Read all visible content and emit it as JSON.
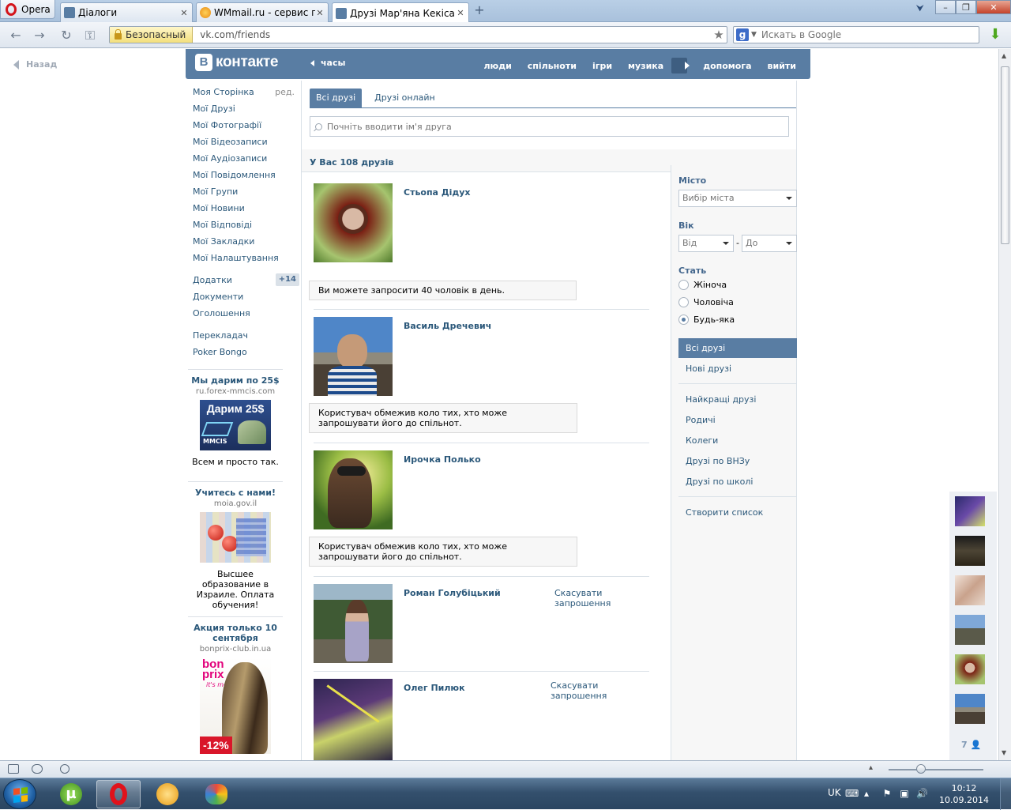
{
  "browser": {
    "opera_label": "Opera",
    "tabs": [
      {
        "label": "Діалоги",
        "close": "✕"
      },
      {
        "label": "WMmail.ru - сервис п...",
        "close": "✕"
      },
      {
        "label": "Друзі Мар'яна Кекіса |...",
        "close": "✕"
      }
    ],
    "new_tab": "+",
    "address": {
      "security": "Безопасный",
      "url": "vk.com/friends"
    },
    "search": {
      "engine_icon": "g",
      "placeholder": "Искать в Google"
    },
    "window_controls": {
      "minimize": "–",
      "restore": "❐",
      "close": "✕"
    }
  },
  "page": {
    "back_label": "Назад",
    "header": {
      "logo_letter": "В",
      "logo_text": "контакте",
      "player_label": "часы",
      "menu": [
        "люди",
        "спільноти",
        "ігри",
        "музика",
        "допомога",
        "вийти"
      ]
    },
    "left_menu": {
      "edit": "ред.",
      "items": [
        "Моя Сторінка",
        "Мої Друзі",
        "Мої Фотографії",
        "Мої Відеозаписи",
        "Мої Аудіозаписи",
        "Мої Повідомлення",
        "Мої Групи",
        "Мої Новини",
        "Мої Відповіді",
        "Мої Закладки",
        "Мої Налаштування"
      ],
      "apps": "Додатки",
      "apps_badge": "+14",
      "extra": [
        "Документи",
        "Оголошення"
      ],
      "tools": [
        "Перекладач",
        "Poker Bongo"
      ]
    },
    "ads": [
      {
        "title": "Мы дарим по 25$",
        "domain": "ru.forex-mmcis.com",
        "img_title": "Дарим 25$",
        "img_brand": "MMCIS",
        "text": "Всем и просто так."
      },
      {
        "title": "Учитесь с нами!",
        "domain": "moia.gov.il",
        "text": "Высшее образование в Израиле. Оплата обучения!"
      },
      {
        "title": "Акция только 10 сентября",
        "domain": "bonprix-club.in.ua",
        "img_brand": "bon prix",
        "img_tag": "it's me!",
        "img_discount": "-12%"
      }
    ],
    "friends_tabs": [
      "Всі друзі",
      "Друзі онлайн"
    ],
    "search_placeholder": "Почніть вводити ім'я друга",
    "count_text": "У Вас 108 друзів",
    "friends": [
      {
        "name": "Стьопа Дідух",
        "notice": "Ви можете запросити 40 чоловік в день."
      },
      {
        "name": "Василь Дречевич",
        "notice": "Користувач обмежив коло тих, хто може запрошувати його до спільнот."
      },
      {
        "name": "Ирочка Полько",
        "notice": "Користувач обмежив коло тих, хто може запрошувати його до спільнот."
      },
      {
        "name": "Роман Голубіцький",
        "cancel": "Скасувати запрошення"
      },
      {
        "name": "Олег Пилюк",
        "cancel": "Скасувати запрошення"
      }
    ],
    "filter": {
      "city_label": "Місто",
      "city_select": "Вибір міста",
      "age_label": "Вік",
      "age_from": "Від",
      "age_dash": "-",
      "age_to": "До",
      "sex_label": "Стать",
      "sex_options": [
        "Жіноча",
        "Чоловіча",
        "Будь-яка"
      ],
      "sex_selected": "Будь-яка",
      "nav_primary": [
        "Всі друзі",
        "Нові друзі"
      ],
      "nav_lists": [
        "Найкращі друзі",
        "Родичі",
        "Колеги",
        "Друзі по ВНЗу",
        "Друзі по школі"
      ],
      "create_list": "Створити список"
    },
    "online_count": "7"
  },
  "taskbar": {
    "lang": "UK",
    "time": "10:12",
    "date": "10.09.2014"
  },
  "colors": {
    "vk_blue": "#597da3",
    "link": "#2b587a",
    "opera_red": "#d4141b"
  }
}
